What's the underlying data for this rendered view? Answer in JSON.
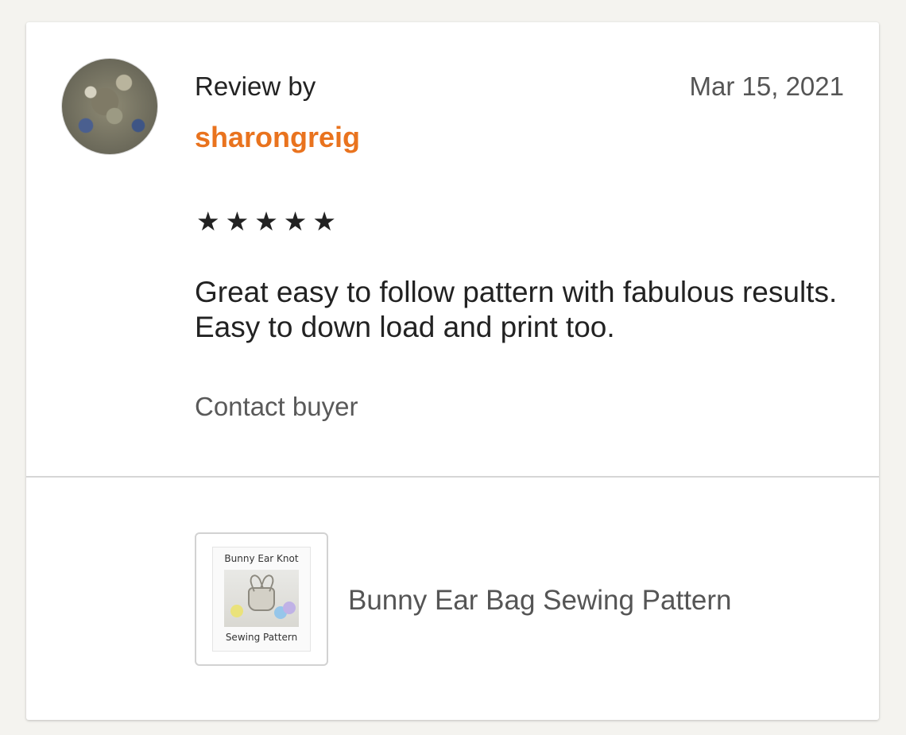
{
  "review": {
    "review_by_label": "Review by",
    "username": "sharongreig",
    "date": "Mar 15, 2021",
    "rating": 5,
    "stars": [
      "★",
      "★",
      "★",
      "★",
      "★"
    ],
    "text": "Great easy to follow pattern with fabulous results. Easy to down load and print too.",
    "contact_label": "Contact buyer"
  },
  "product": {
    "thumbnail_top_text": "Bunny Ear Knot",
    "thumbnail_bottom_text": "Sewing Pattern",
    "title": "Bunny Ear Bag Sewing Pattern"
  },
  "colors": {
    "username": "#e9731e",
    "background": "#f4f3ef",
    "card": "#ffffff"
  }
}
